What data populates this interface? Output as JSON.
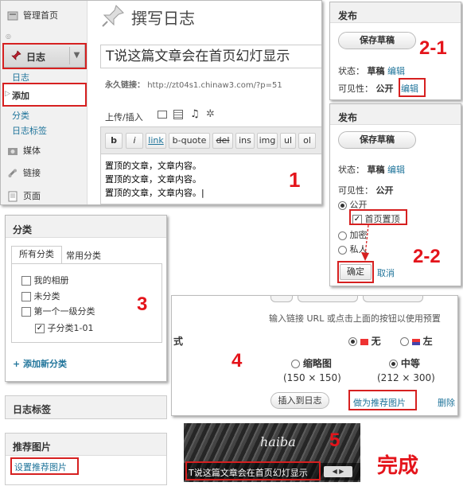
{
  "panel1": {
    "sidebar": {
      "dashboard": "管理首页",
      "posts": "日志",
      "posts_sub": "日志",
      "add_new": "添加",
      "categories": "分类",
      "tags": "日志标签",
      "media": "媒体",
      "links": "链接",
      "pages": "页面"
    },
    "page_title": "撰写日志",
    "post_title": "T说这篇文章会在首页幻灯显示",
    "permalink_label": "永久链接：",
    "permalink_url": "http://zt04s1.chinaw3.com/?p=51",
    "upload_label": "上传/插入",
    "toolbar": [
      "b",
      "i",
      "link",
      "b-quote",
      "del",
      "ins",
      "img",
      "ul",
      "ol"
    ],
    "content_lines": [
      "置顶的文章，文章内容。",
      "置顶的文章，文章内容。",
      "置顶的文章，文章内容。"
    ],
    "step": "1"
  },
  "panel21": {
    "title": "发布",
    "save_draft": "保存草稿",
    "status_label": "状态：",
    "status_value": "草稿",
    "edit": "编辑",
    "visibility_label": "可见性：",
    "visibility_value": "公开",
    "step": "2-1"
  },
  "panel22": {
    "title": "发布",
    "save_draft": "保存草稿",
    "status_label": "状态：",
    "status_value": "草稿",
    "edit": "编辑",
    "visibility_label": "可见性：",
    "visibility_value": "公开",
    "opt_public": "公开",
    "opt_sticky": "首页置顶",
    "opt_password": "加密",
    "opt_private": "私人",
    "ok": "确定",
    "cancel": "取消",
    "step": "2-2"
  },
  "panel3": {
    "title": "分类",
    "tab_all": "所有分类",
    "tab_common": "常用分类",
    "cats": [
      "我的相册",
      "未分类",
      "第一个一级分类",
      "子分类1-01"
    ],
    "add_new": "+ 添加新分类",
    "step": "3"
  },
  "panel_tags": {
    "title": "日志标签"
  },
  "panel_featured": {
    "title": "推荐图片",
    "set_link": "设置推荐图片"
  },
  "panel4": {
    "hint": "输入链接 URL 或点击上面的按钮以使用预置",
    "align_label": "式",
    "align_none": "无",
    "align_left": "左",
    "size_thumb": "缩略图",
    "size_thumb_dim": "(150 × 150)",
    "size_medium": "中等",
    "size_medium_dim": "(212 × 300)",
    "insert": "插入到日志",
    "use_featured": "做为推荐图片",
    "delete": "删除",
    "step": "4"
  },
  "panel5": {
    "logo": "haiba",
    "caption": "T说这篇文章会在首页幻灯显示",
    "step": "5",
    "done": "完成"
  }
}
